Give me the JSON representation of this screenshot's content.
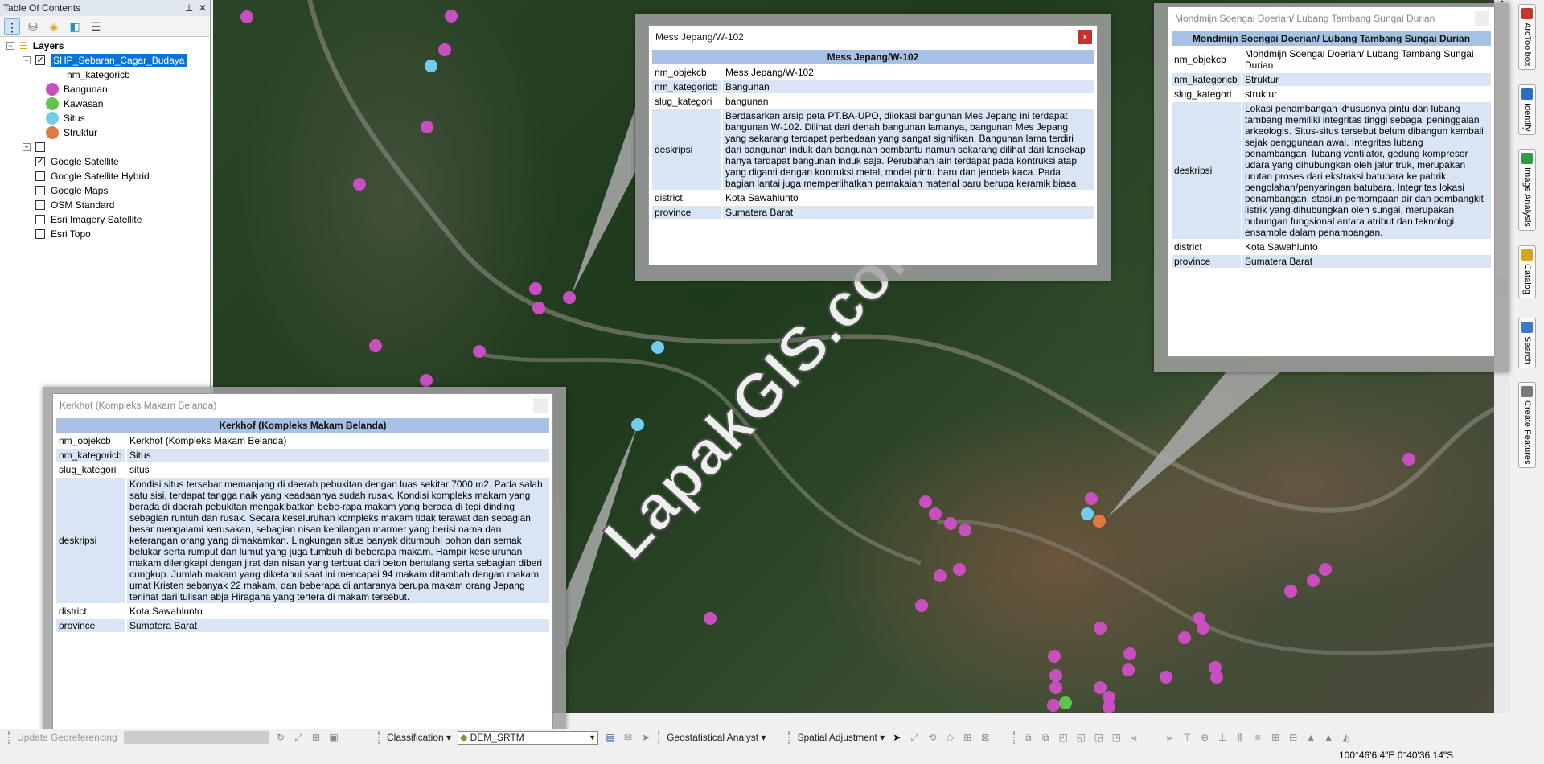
{
  "toc": {
    "title": "Table Of Contents",
    "pin_icon": "pin-icon",
    "close_icon": "close-icon",
    "root": "Layers",
    "layer": {
      "name": "SHP_Sebaran_Cagar_Budaya",
      "checked": true,
      "field": "nm_kategoricb",
      "classes": [
        {
          "label": "Bangunan",
          "color": "#c94fc0"
        },
        {
          "label": "Kawasan",
          "color": "#5ec44c"
        },
        {
          "label": "Situs",
          "color": "#70cdee"
        },
        {
          "label": "Struktur",
          "color": "#e07a45"
        }
      ]
    },
    "basemaps": [
      {
        "label": "Google Satellite",
        "checked": true
      },
      {
        "label": "Google Satellite Hybrid",
        "checked": false
      },
      {
        "label": "Google Maps",
        "checked": false
      },
      {
        "label": "OSM Standard",
        "checked": false
      },
      {
        "label": "Esri Imagery Satellite",
        "checked": false
      },
      {
        "label": "Esri Topo",
        "checked": false
      }
    ]
  },
  "popups": {
    "mess": {
      "title": "Mess Jepang/W-102",
      "header": "Mess Jepang/W-102",
      "close": "x",
      "rows": [
        {
          "k": "nm_objekcb",
          "v": "Mess Jepang/W-102"
        },
        {
          "k": "nm_kategoricb",
          "v": "Bangunan"
        },
        {
          "k": "slug_kategori",
          "v": "bangunan"
        },
        {
          "k": "deskripsi",
          "v": "Berdasarkan arsip peta PT.BA-UPO, dilokasi bangunan Mes Jepang ini terdapat bangunan W-102. Dilihat dari denah bangunan lamanya, bangunan Mes Jepang yang sekarang terdapat perbedaan yang sangat signifikan. Bangunan lama terdiri dari bangunan induk dan bangunan pembantu namun sekarang dilihat dari lansekap hanya terdapat bangunan induk saja. Perubahan lain terdapat pada kontruksi atap yang diganti dengan kontruksi metal, model pintu baru dan jendela kaca. Pada bagian lantai juga memperlihatkan pemakaian material baru berupa keramik biasa"
        },
        {
          "k": "district",
          "v": "Kota Sawahlunto"
        },
        {
          "k": "province",
          "v": "Sumatera Barat"
        }
      ]
    },
    "mondmijn": {
      "title": "Mondmijn Soengai Doerian/ Lubang Tambang Sungai Durian",
      "header": "Mondmijn Soengai Doerian/ Lubang Tambang Sungai Durian",
      "rows": [
        {
          "k": "nm_objekcb",
          "v": "Mondmijn Soengai Doerian/ Lubang Tambang Sungai Durian"
        },
        {
          "k": "nm_kategoricb",
          "v": "Struktur"
        },
        {
          "k": "slug_kategori",
          "v": "struktur"
        },
        {
          "k": "deskripsi",
          "v": "Lokasi penambangan khususnya pintu dan lubang tambang memiliki integritas tinggi sebagai peninggalan arkeologis. Situs-situs tersebut belum dibangun kembali sejak penggunaan awal. Integritas lubang penambangan, lubang ventilator, gedung kompresor udara yang dihubungkan oleh jalur truk, merupakan urutan proses dari ekstraksi batubara ke pabrik pengolahan/penyaringan batubara. Integritas lokasi penambangan, stasiun pemompaan air dan pembangkit listrik yang dihubungkan oleh sungai, merupakan hubungan fungsional antara atribut dan teknologi ensamble dalam penambangan."
        },
        {
          "k": "district",
          "v": "Kota Sawahlunto"
        },
        {
          "k": "province",
          "v": "Sumatera Barat"
        }
      ]
    },
    "kerkhof": {
      "title": "Kerkhof (Kompleks Makam Belanda)",
      "header": "Kerkhof (Kompleks Makam Belanda)",
      "rows": [
        {
          "k": "nm_objekcb",
          "v": "Kerkhof (Kompleks Makam Belanda)"
        },
        {
          "k": "nm_kategoricb",
          "v": "Situs"
        },
        {
          "k": "slug_kategori",
          "v": "situs"
        },
        {
          "k": "deskripsi",
          "v": "Kondisi situs tersebar memanjang di daerah pebukitan dengan luas sekitar 7000 m2. Pada salah satu sisi, terdapat tangga naik yang keadaannya sudah rusak. Kondisi kompleks makam yang berada di daerah pebukitan mengakibatkan bebe-rapa makam yang berada di tepi dinding sebagian runtuh dan rusak. Secara keseluruhan kompleks makam tidak terawat dan sebagian besar mengalami kerusakan, sebagian nisan kehilangan marmer yang berisi nama dan keterangan orang yang dimakamkan. Lingkungan situs banyak ditumbuhi pohon dan semak belukar serta rumput dan lumut yang juga tumbuh di beberapa makam. Hampir keseluruhan makam dilengkapi dengan jirat dan nisan yang terbuat dari beton bertulang serta sebagian diberi cungkup. Jumlah makam yang diketahui saat ini mencapai 94 makam ditambah dengan makam umat Kristen sebanyak 22 makam, dan beberapa di antaranya berupa makam orang Jepang terlihat dari tulisan abja Hiragana yang tertera di makam tersebut."
        },
        {
          "k": "district",
          "v": "Kota Sawahlunto"
        },
        {
          "k": "province",
          "v": "Sumatera Barat"
        }
      ]
    }
  },
  "watermark": "LapakGIS.com",
  "right_tabs": [
    "ArcToolbox",
    "Identify",
    "Image Analysis",
    "Catalog",
    "Search",
    "Create Features"
  ],
  "toolbar": {
    "georef": "Update Georeferencing",
    "classification": "Classification",
    "layer_select": "DEM_SRTM",
    "geostat": "Geostatistical Analyst",
    "spatial_adj": "Spatial Adjustment"
  },
  "status": {
    "coords": "100°46'6.4\"E  0°40'36.14\"S"
  }
}
